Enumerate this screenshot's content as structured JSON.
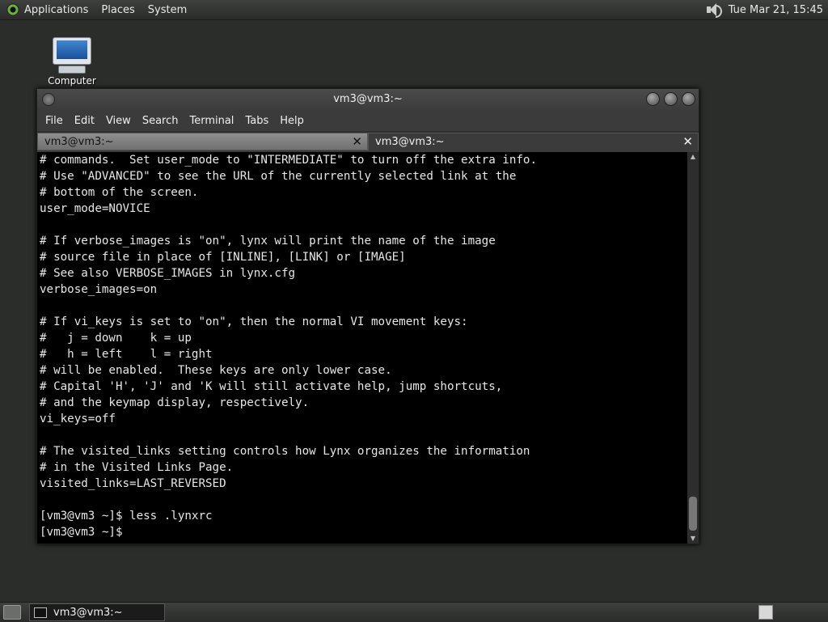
{
  "top_panel": {
    "menus": [
      "Applications",
      "Places",
      "System"
    ],
    "clock": "Tue Mar 21, 15:45",
    "icons": {
      "menu_logo": "distro-logo-icon",
      "volume": "volume-icon"
    }
  },
  "desktop": {
    "icons": [
      {
        "label": "Computer",
        "icon": "computer-icon"
      }
    ]
  },
  "window": {
    "title": "vm3@vm3:~",
    "menu": [
      "File",
      "Edit",
      "View",
      "Search",
      "Terminal",
      "Tabs",
      "Help"
    ],
    "tabs": [
      {
        "label": "vm3@vm3:~",
        "active": false
      },
      {
        "label": "vm3@vm3:~",
        "active": true
      }
    ],
    "terminal_lines": [
      "# commands.  Set user_mode to \"INTERMEDIATE\" to turn off the extra info.",
      "# Use \"ADVANCED\" to see the URL of the currently selected link at the",
      "# bottom of the screen.",
      "user_mode=NOVICE",
      "",
      "# If verbose_images is \"on\", lynx will print the name of the image",
      "# source file in place of [INLINE], [LINK] or [IMAGE]",
      "# See also VERBOSE_IMAGES in lynx.cfg",
      "verbose_images=on",
      "",
      "# If vi_keys is set to \"on\", then the normal VI movement keys:",
      "#   j = down    k = up",
      "#   h = left    l = right",
      "# will be enabled.  These keys are only lower case.",
      "# Capital 'H', 'J' and 'K will still activate help, jump shortcuts,",
      "# and the keymap display, respectively.",
      "vi_keys=off",
      "",
      "# The visited_links setting controls how Lynx organizes the information",
      "# in the Visited Links Page.",
      "visited_links=LAST_REVERSED",
      "",
      "[vm3@vm3 ~]$ less .lynxrc",
      "[vm3@vm3 ~]$"
    ]
  },
  "bottom_panel": {
    "tasks": [
      {
        "label": "vm3@vm3:~",
        "icon": "terminal-icon"
      }
    ]
  }
}
